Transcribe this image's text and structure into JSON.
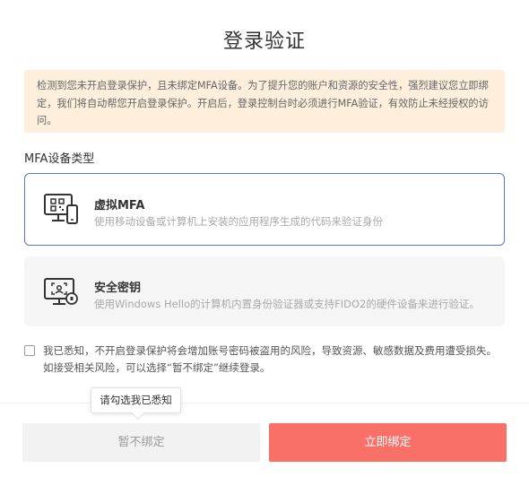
{
  "dialog": {
    "title": "登录验证",
    "notice": "检测到您未开启登录保护，且未绑定MFA设备。为了提升您的账户和资源的安全性，强烈建议您立即绑定，我们将自动帮您开启登录保护。开启后，登录控制台时必须进行MFA验证，有效防止未经授权的访问。",
    "section_label": "MFA设备类型",
    "options": [
      {
        "name": "虚拟MFA",
        "description": "使用移动设备或计算机上安装的应用程序生成的代码来验证身份",
        "icon": "virtual-mfa-devices-icon",
        "selected": true
      },
      {
        "name": "安全密钥",
        "description": "使用Windows Hello的计算机内置身份验证器或支持FIDO2的硬件设备来进行验证。",
        "icon": "security-key-icon",
        "selected": false
      }
    ],
    "consent": {
      "checked": false,
      "text": "我已悉知，不开启登录保护将会增加账号密码被盗用的风险，导致资源、敏感数据及费用遭受损失。如接受相关风险，可以选择“暂不绑定”继续登录。"
    },
    "tooltip": "请勾选我已悉知",
    "buttons": {
      "skip": "暂不绑定",
      "bind": "立即绑定"
    }
  },
  "colors": {
    "accent_border": "#5876c5",
    "notice_bg": "#fdefdc",
    "primary_button": "#f87068",
    "secondary_button": "#f2f2f2"
  }
}
